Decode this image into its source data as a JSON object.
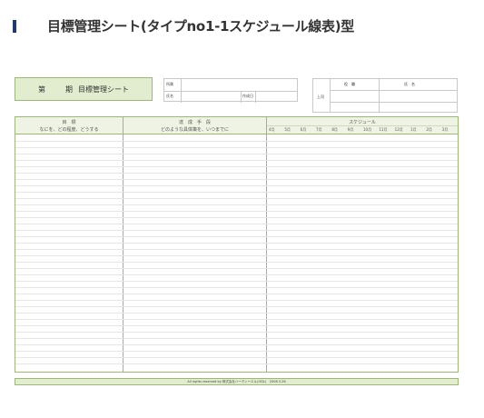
{
  "page": {
    "title": "目標管理シート(タイプno1-1スケジュール線表)型"
  },
  "sheet": {
    "title_label_1": "第",
    "title_label_2": "期",
    "title_label_3": "目標管理シート",
    "info": {
      "affiliation_label": "所属",
      "name_label": "氏名",
      "created_date_label": "作成日"
    },
    "approval": {
      "position_header": "役　職",
      "name_header": "氏　名",
      "boss_label": "上司"
    },
    "columns": {
      "goal_header": "目　標",
      "goal_sub": "なにを、どの程度、どうする",
      "means_header": "達　成　手　段",
      "means_sub": "どのような具体策を、いつまでに",
      "schedule_header": "スケジュール",
      "months": [
        "4月",
        "5月",
        "6月",
        "7月",
        "8月",
        "9月",
        "10月",
        "11月",
        "12月",
        "1月",
        "2月",
        "3月"
      ]
    },
    "footer": "All rights reserved by 株式会社ハーディーエル(ODL)　2008.3.26"
  }
}
